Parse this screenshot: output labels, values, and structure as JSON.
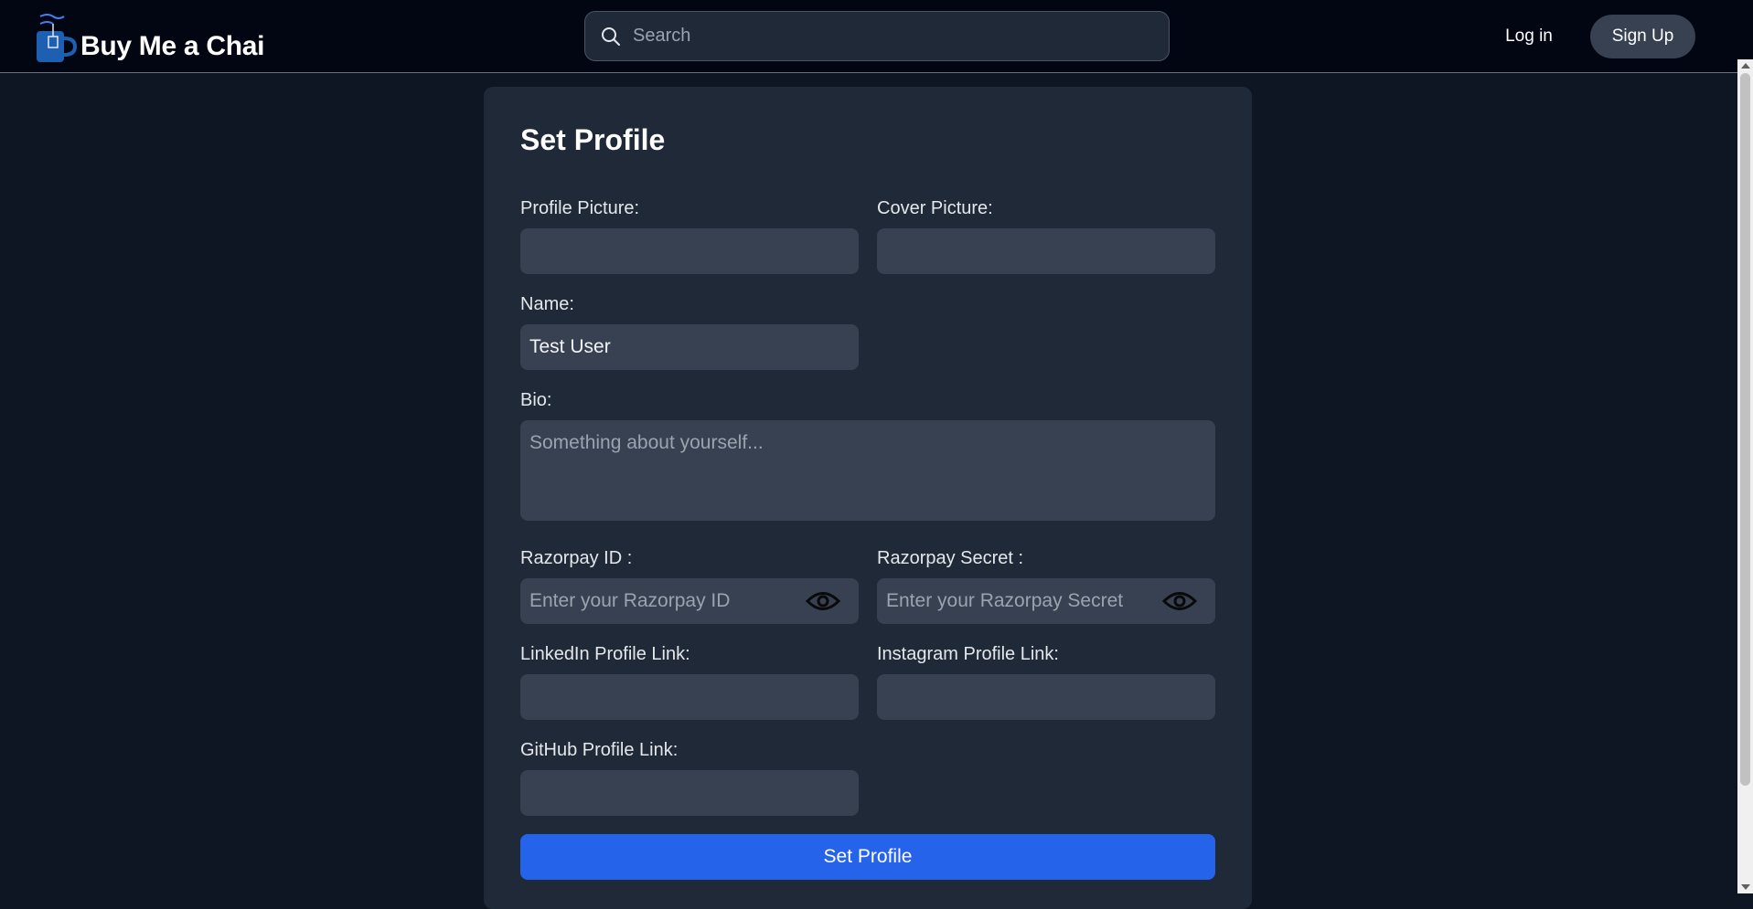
{
  "header": {
    "brand": "Buy Me a Chai",
    "search_placeholder": "Search",
    "login_label": "Log in",
    "signup_label": "Sign Up"
  },
  "form": {
    "title": "Set Profile",
    "profile_picture": {
      "label": "Profile Picture:",
      "value": ""
    },
    "cover_picture": {
      "label": "Cover Picture:",
      "value": ""
    },
    "name": {
      "label": "Name:",
      "value": "Test User"
    },
    "bio": {
      "label": "Bio:",
      "placeholder": "Something about yourself..."
    },
    "razorpay_id": {
      "label": "Razorpay ID :",
      "placeholder": "Enter your Razorpay ID"
    },
    "razorpay_secret": {
      "label": "Razorpay Secret :",
      "placeholder": "Enter your Razorpay Secret"
    },
    "linkedin": {
      "label": "LinkedIn Profile Link:",
      "value": ""
    },
    "instagram": {
      "label": "Instagram Profile Link:",
      "value": ""
    },
    "github": {
      "label": "GitHub Profile Link:",
      "value": ""
    },
    "submit_label": "Set Profile"
  },
  "icons": {
    "logo": "chai-cup-icon",
    "search": "search-icon",
    "toggle_visibility": "eye-icon"
  },
  "colors": {
    "background": "#0f1623",
    "navbar": "#020612",
    "card": "#1f2937",
    "input": "#374151",
    "primary": "#2563eb",
    "logo_blue": "#1d5fb0"
  }
}
